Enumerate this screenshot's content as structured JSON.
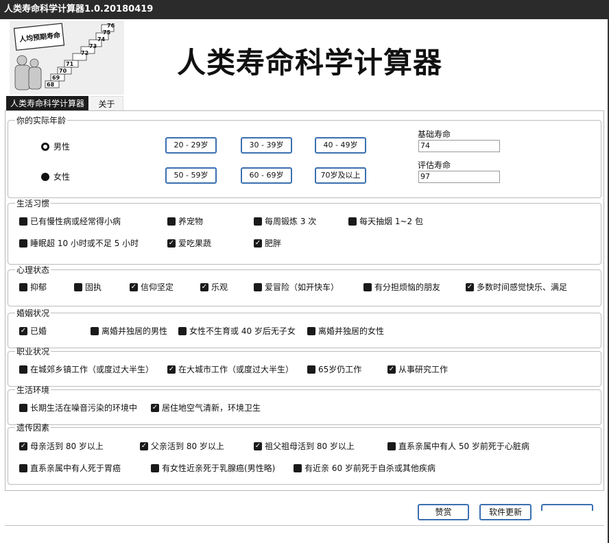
{
  "window": {
    "title": "人类寿命科学计算器1.0.20180419"
  },
  "header": {
    "app_title": "人类寿命科学计算器",
    "logo": {
      "sign_text": "人均预期寿命",
      "steps": [
        "68",
        "69",
        "70",
        "71",
        "72",
        "73",
        "74",
        "75",
        "76"
      ]
    }
  },
  "tabs": [
    {
      "label": "人类寿命科学计算器"
    },
    {
      "label": "关于"
    }
  ],
  "age_section": {
    "legend": "你的实际年龄",
    "gender": [
      {
        "label": "男性",
        "selected": true
      },
      {
        "label": "女性",
        "selected": false
      }
    ],
    "age_buttons": [
      "20 - 29岁",
      "30 - 39岁",
      "40 - 49岁",
      "50 - 59岁",
      "60 - 69岁",
      "70岁及以上"
    ],
    "base_life_label": "基础寿命",
    "base_life_value": "74",
    "estimated_life_label": "评估寿命",
    "estimated_life_value": "97"
  },
  "lifestyle": {
    "legend": "生活习惯",
    "items": [
      {
        "label": "已有慢性病或经常得小病",
        "checked": false
      },
      {
        "label": "养宠物",
        "checked": false
      },
      {
        "label": "每周锻炼 3 次",
        "checked": false
      },
      {
        "label": "每天抽烟 1~2 包",
        "checked": false
      },
      {
        "label": "睡眠超 10 小时或不足 5 小时",
        "checked": false
      },
      {
        "label": "爱吃果蔬",
        "checked": true
      },
      {
        "label": "肥胖",
        "checked": true
      }
    ]
  },
  "psychology": {
    "legend": "心理状态",
    "items": [
      {
        "label": "抑郁",
        "checked": false
      },
      {
        "label": "固执",
        "checked": false
      },
      {
        "label": "信仰坚定",
        "checked": true
      },
      {
        "label": "乐观",
        "checked": true
      },
      {
        "label": "爱冒险（如开快车）",
        "checked": false
      },
      {
        "label": "有分担烦恼的朋友",
        "checked": false
      },
      {
        "label": "多数时间感觉快乐、满足",
        "checked": true
      }
    ]
  },
  "marriage": {
    "legend": "婚姻状况",
    "items": [
      {
        "label": "已婚",
        "checked": true
      },
      {
        "label": "离婚并独居的男性",
        "checked": false
      },
      {
        "label": "女性不生育或 40 岁后无子女",
        "checked": false
      },
      {
        "label": "离婚并独居的女性",
        "checked": false
      }
    ]
  },
  "career": {
    "legend": "职业状况",
    "items": [
      {
        "label": "在城郊乡镇工作（或度过大半生）",
        "checked": false
      },
      {
        "label": "在大城市工作（或度过大半生）",
        "checked": true
      },
      {
        "label": "65岁仍工作",
        "checked": false
      },
      {
        "label": "从事研究工作",
        "checked": true
      }
    ]
  },
  "environment": {
    "legend": "生活环境",
    "items": [
      {
        "label": "长期生活在噪音污染的环境中",
        "checked": false
      },
      {
        "label": "居住地空气清新，环境卫生",
        "checked": true
      }
    ]
  },
  "genetics": {
    "legend": "遗传因素",
    "items": [
      {
        "label": "母亲活到 80 岁以上",
        "checked": true
      },
      {
        "label": "父亲活到 80 岁以上",
        "checked": true
      },
      {
        "label": "祖父祖母活到 80 岁以上",
        "checked": true
      },
      {
        "label": "直系亲属中有人 50 岁前死于心脏病",
        "checked": false
      },
      {
        "label": "直系亲属中有人死于胃癌",
        "checked": false
      },
      {
        "label": "有女性近亲死于乳腺癌(男性略)",
        "checked": false
      },
      {
        "label": "有近亲 60 岁前死于自杀或其他疾病",
        "checked": false
      }
    ]
  },
  "footer": {
    "buttons": [
      "赞赏",
      "软件更新",
      ""
    ]
  }
}
